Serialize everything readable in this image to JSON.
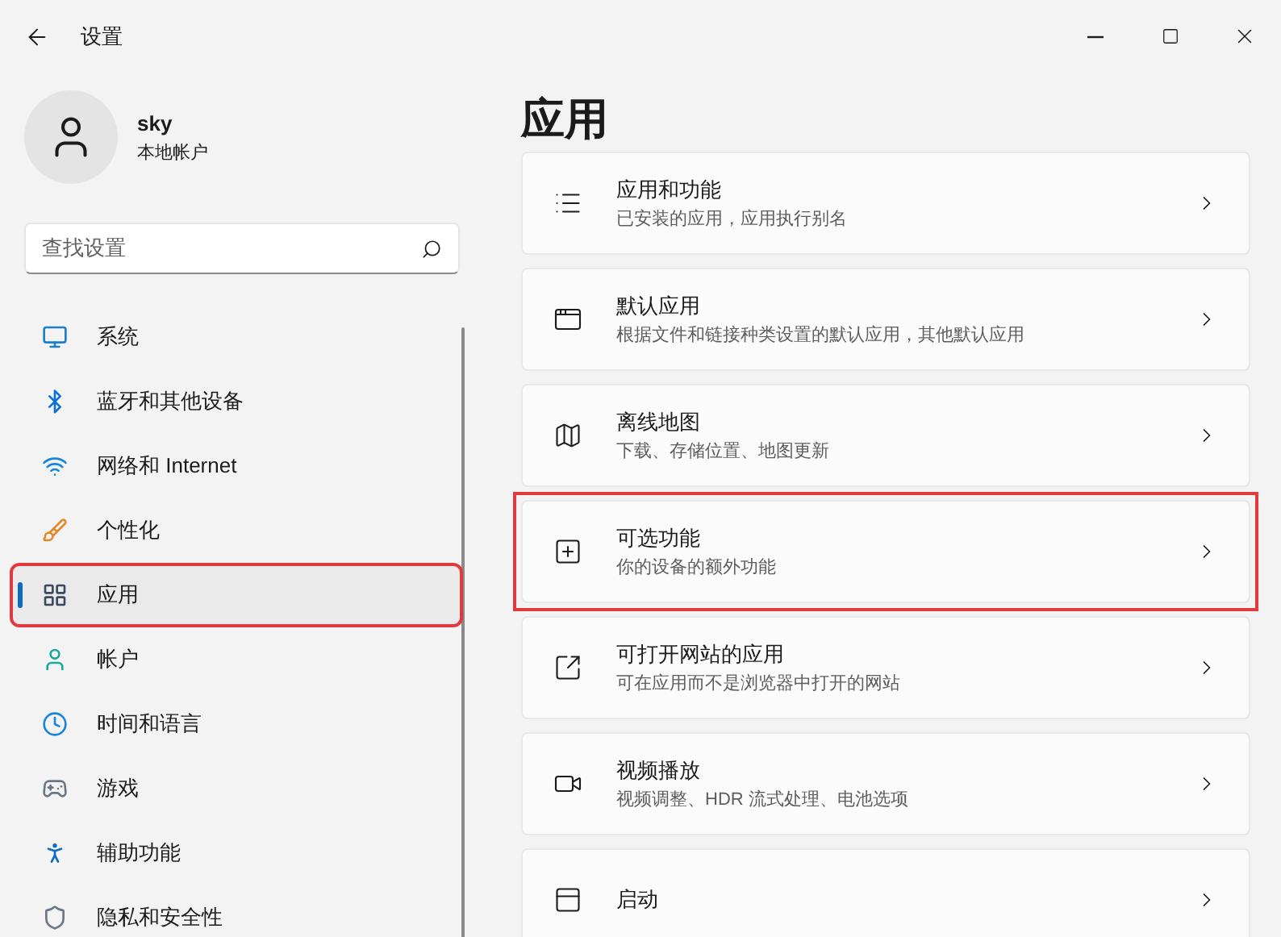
{
  "window": {
    "title": "设置"
  },
  "account": {
    "name": "sky",
    "type": "本地帐户"
  },
  "search": {
    "placeholder": "查找设置"
  },
  "sidebar": {
    "items": [
      {
        "label": "系统",
        "selected": false,
        "highlighted": false
      },
      {
        "label": "蓝牙和其他设备",
        "selected": false,
        "highlighted": false
      },
      {
        "label": "网络和 Internet",
        "selected": false,
        "highlighted": false
      },
      {
        "label": "个性化",
        "selected": false,
        "highlighted": false
      },
      {
        "label": "应用",
        "selected": true,
        "highlighted": true
      },
      {
        "label": "帐户",
        "selected": false,
        "highlighted": false
      },
      {
        "label": "时间和语言",
        "selected": false,
        "highlighted": false
      },
      {
        "label": "游戏",
        "selected": false,
        "highlighted": false
      },
      {
        "label": "辅助功能",
        "selected": false,
        "highlighted": false
      },
      {
        "label": "隐私和安全性",
        "selected": false,
        "highlighted": false
      }
    ]
  },
  "page": {
    "title": "应用",
    "cards": [
      {
        "title": "应用和功能",
        "subtitle": "已安装的应用，应用执行别名",
        "highlighted": false
      },
      {
        "title": "默认应用",
        "subtitle": "根据文件和链接种类设置的默认应用，其他默认应用",
        "highlighted": false
      },
      {
        "title": "离线地图",
        "subtitle": "下载、存储位置、地图更新",
        "highlighted": false
      },
      {
        "title": "可选功能",
        "subtitle": "你的设备的额外功能",
        "highlighted": true
      },
      {
        "title": "可打开网站的应用",
        "subtitle": "可在应用而不是浏览器中打开的网站",
        "highlighted": false
      },
      {
        "title": "视频播放",
        "subtitle": "视频调整、HDR 流式处理、电池选项",
        "highlighted": false
      },
      {
        "title": "启动",
        "highlighted": false
      }
    ]
  }
}
